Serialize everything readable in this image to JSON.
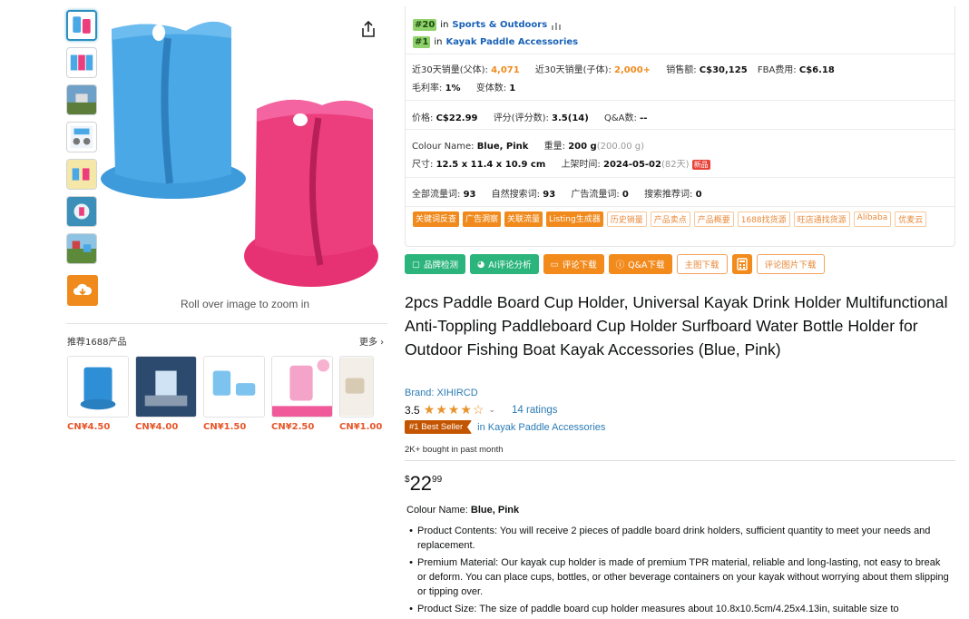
{
  "gallery": {
    "zoom_hint": "Roll over image to zoom in"
  },
  "recommend": {
    "title": "推荐1688产品",
    "more": "更多 ›",
    "items": [
      {
        "price": "CN¥4.50"
      },
      {
        "price": "CN¥4.00"
      },
      {
        "price": "CN¥1.50"
      },
      {
        "price": "CN¥2.50"
      },
      {
        "price": "CN¥1.00"
      }
    ]
  },
  "panel": {
    "rank1": {
      "badge": "#20",
      "prefix": "in",
      "category": "Sports & Outdoors"
    },
    "rank2": {
      "badge": "#1",
      "prefix": "in",
      "category": "Kayak Paddle Accessories"
    },
    "sales_parent_label": "近30天销量(父体):",
    "sales_parent_value": "4,071",
    "sales_child_label": "近30天销量(子体):",
    "sales_child_value": "2,000+",
    "revenue_label": "销售额:",
    "revenue_value": "C$30,125",
    "fba_label": "FBA费用:",
    "fba_value": "C$6.18",
    "margin_label": "毛利率:",
    "margin_value": "1%",
    "variants_label": "变体数:",
    "variants_value": "1",
    "price_label": "价格:",
    "price_value": "C$22.99",
    "rating_label": "评分(评分数):",
    "rating_value": "3.5(14)",
    "qa_label": "Q&A数:",
    "qa_value": "--",
    "colour_label": "Colour Name:",
    "colour_value": "Blue, Pink",
    "weight_label": "重量:",
    "weight_value": "200 g",
    "weight_detail": "(200.00 g)",
    "size_label": "尺寸:",
    "size_value": "12.5 x 11.4 x 10.9 cm",
    "listed_label": "上架时间:",
    "listed_value": "2024-05-02",
    "listed_detail": "(82天)",
    "new_badge": "新品",
    "traffic_all_label": "全部流量词:",
    "traffic_all_value": "93",
    "traffic_organic_label": "自然搜索词:",
    "traffic_organic_value": "93",
    "traffic_ad_label": "广告流量词:",
    "traffic_ad_value": "0",
    "traffic_rec_label": "搜索推荐词:",
    "traffic_rec_value": "0",
    "tags_solid": [
      "关键词反查",
      "广告洞察",
      "关联流量",
      "Listing生成器"
    ],
    "tags_outline": [
      "历史销量",
      "产品卖点",
      "产品概要",
      "1688找货源",
      "旺店通找货源",
      "Alibaba",
      "优麦云"
    ]
  },
  "tools": {
    "brand_check": "品牌检测",
    "ai_review": "AI评论分析",
    "review_download": "评论下载",
    "qa_download": "Q&A下载",
    "main_img_download": "主图下载",
    "review_img_download": "评论图片下载"
  },
  "product": {
    "title": "2pcs Paddle Board Cup Holder, Universal Kayak Drink Holder Multifunctional Anti-Toppling Paddleboard Cup Holder Surfboard Water Bottle Holder for Outdoor Fishing Boat Kayak Accessories (Blue, Pink)",
    "brand": "Brand: XIHIRCD",
    "rating_value": "3.5",
    "stars": "★★★★☆",
    "ratings_count": "14 ratings",
    "best_seller_badge": "#1 Best Seller",
    "best_seller_category": "in Kayak Paddle Accessories",
    "bought": "2K+ bought in past month",
    "price_symbol": "$",
    "price_whole": "22",
    "price_fraction": "99",
    "colour_label": "Colour Name: ",
    "colour_value": "Blue, Pink",
    "bullets": [
      "Product Contents: You will receive 2 pieces of paddle board drink holders, sufficient quantity to meet your needs and replacement.",
      "Premium Material: Our kayak cup holder is made of premium TPR material, reliable and long-lasting, not easy to break or deform. You can place cups, bottles, or other beverage containers on your kayak without worrying about them slipping or tipping over.",
      "Product Size: The size of paddle board cup holder measures about 10.8x10.5cm/4.25x4.13in, suitable size to"
    ]
  },
  "colors": {
    "accent_orange": "#f08a1c",
    "link_blue": "#2a7bb5",
    "badge_green": "#8fd16a",
    "holder_blue": "#4aa8e6",
    "holder_pink": "#ec3d7d"
  }
}
